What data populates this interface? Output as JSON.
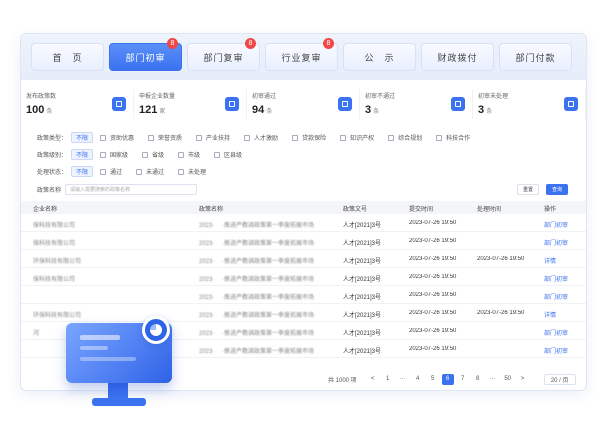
{
  "tabs": [
    {
      "label": "首　页",
      "badge": ""
    },
    {
      "label": "部门初审",
      "badge": "8",
      "active": true
    },
    {
      "label": "部门复审",
      "badge": "8"
    },
    {
      "label": "行业复审",
      "badge": "8"
    },
    {
      "label": "公　示",
      "badge": ""
    },
    {
      "label": "财政拨付",
      "badge": ""
    },
    {
      "label": "部门付款",
      "badge": ""
    }
  ],
  "stats": [
    {
      "label": "发布政策数",
      "value": "100",
      "unit": "条",
      "icon": "document-icon"
    },
    {
      "label": "申报企业数量",
      "value": "121",
      "unit": "家",
      "icon": "stack-icon"
    },
    {
      "label": "初审通过",
      "value": "94",
      "unit": "条",
      "icon": "inbox-icon"
    },
    {
      "label": "初审不通过",
      "value": "3",
      "unit": "条",
      "icon": "document-icon"
    },
    {
      "label": "初审未处理",
      "value": "3",
      "unit": "条",
      "icon": "eye-icon"
    }
  ],
  "filters": {
    "type_label": "政策类型：",
    "type_all": "不限",
    "type_opts": [
      "资助优惠",
      "荣誉资质",
      "产业扶持",
      "人才激励",
      "贷款保险",
      "知识产权",
      "综合规划",
      "科技合作"
    ],
    "level_label": "政策级别：",
    "level_all": "不限",
    "level_opts": [
      "国家级",
      "省级",
      "市级",
      "区县级"
    ],
    "status_label": "处理状态：",
    "status_all": "不限",
    "status_opts": [
      "通过",
      "未通过",
      "未处理"
    ],
    "search_label": "政策名称",
    "search_placeholder": "请输入需要搜索的政策名称",
    "reset": "重置",
    "query": "查询"
  },
  "table": {
    "headers": [
      "企业名称",
      "政策名称",
      "政策文号",
      "提交时间",
      "处理时间",
      "操作"
    ],
    "rows": [
      {
        "company": "保科技有限公司",
        "policy": "2023· 　·推进产教调政策第一季度拓展市场",
        "doc": "人才[2021]3号",
        "submit": "2023-07-26 19:50",
        "handled": "",
        "action": "部门初审"
      },
      {
        "company": "保科技有限公司",
        "policy": "2023· 　·推进产教调政策第一季度拓展市场",
        "doc": "人才[2021]3号",
        "submit": "2023-07-26 19:50",
        "handled": "",
        "action": "部门初审"
      },
      {
        "company": "环保科技有限公司",
        "policy": "2023· 　·推进产教调政策第一季度拓展市场",
        "doc": "人才[2021]3号",
        "submit": "2023-07-26 19:50",
        "handled": "2023-07-26 19:50",
        "action": "详情"
      },
      {
        "company": "保科技有限公司",
        "policy": "2023· 　·推进产教调政策第一季度拓展市场",
        "doc": "人才[2021]3号",
        "submit": "2023-07-26 19:50",
        "handled": "",
        "action": "部门初审"
      },
      {
        "company": "",
        "policy": "2023· 　·推进产教调政策第一季度拓展市场",
        "doc": "人才[2021]3号",
        "submit": "2023-07-26 19:50",
        "handled": "",
        "action": "部门初审"
      },
      {
        "company": "环保科技有限公司",
        "policy": "2023· 　·推进产教调政策第一季度拓展市场",
        "doc": "人才[2021]3号",
        "submit": "2023-07-26 19:50",
        "handled": "2023-07-26 19:50",
        "action": "详情"
      },
      {
        "company": "河",
        "policy": "2023· 　·推进产教调政策第一季度拓展市场",
        "doc": "人才[2021]3号",
        "submit": "2023-07-26 19:50",
        "handled": "",
        "action": "部门初审"
      },
      {
        "company": "",
        "policy": "2023· 　·推进产教调政策第一季度拓展市场",
        "doc": "人才[2021]3号",
        "submit": "2023-07-26 19:50",
        "handled": "",
        "action": "部门初审"
      }
    ]
  },
  "pager": {
    "total": "共 1000 项",
    "pages": [
      "<",
      "1",
      "···",
      "4",
      "5",
      "6",
      "7",
      "8",
      "···",
      "50",
      ">"
    ],
    "current": "6",
    "size": "20 / 页"
  }
}
